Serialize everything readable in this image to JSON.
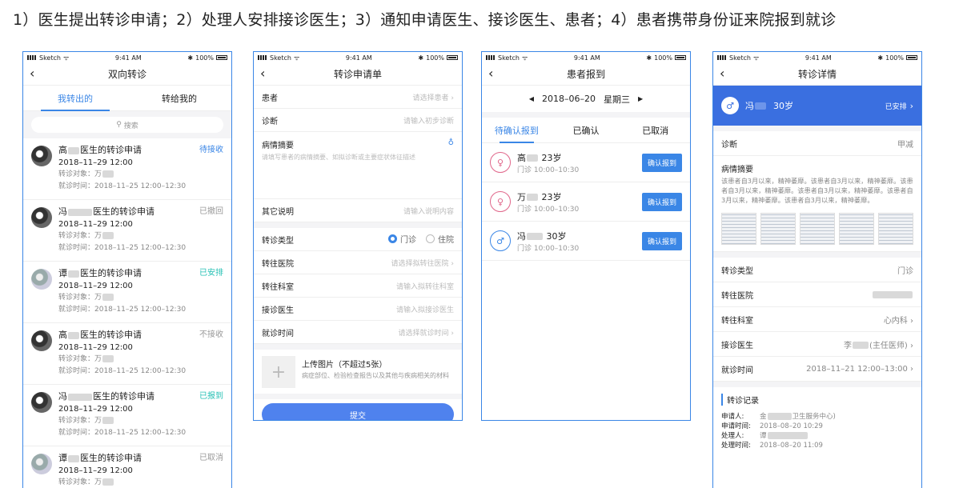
{
  "caption": "1）医生提出转诊申请；2）处理人安排接诊医生；3）通知申请医生、接诊医生、患者；4）患者携带身份证来院报到就诊",
  "statusbar": {
    "carrier": "Sketch",
    "time": "9:41 AM",
    "battery": "100%"
  },
  "phone1": {
    "title": "双向转诊",
    "tabs": [
      "我转出的",
      "转给我的"
    ],
    "search_placeholder": "搜索",
    "items": [
      {
        "name_a": "高",
        "name_b": "医生的转诊申请",
        "status": "待接收",
        "date": "2018–11–29 12:00",
        "target_label": "转诊对象：万",
        "time_text": "就诊时间：2018–11–25 12:00–12:30"
      },
      {
        "name_a": "冯",
        "name_b": "医生的转诊申请",
        "status": "已撤回",
        "date": "2018–11–29 12:00",
        "target_label": "转诊对象：万",
        "time_text": "就诊时间：2018–11–25 12:00–12:30"
      },
      {
        "name_a": "谭",
        "name_b": "医生的转诊申请",
        "status": "已安排",
        "date": "2018–11–29 12:00",
        "target_label": "转诊对象：万",
        "time_text": "就诊时间：2018–11–25 12:00–12:30"
      },
      {
        "name_a": "高",
        "name_b": "医生的转诊申请",
        "status": "不接收",
        "date": "2018–11–29 12:00",
        "target_label": "转诊对象：万",
        "time_text": "就诊时间：2018–11–25 12:00–12:30"
      },
      {
        "name_a": "冯",
        "name_b": "医生的转诊申请",
        "status": "已报到",
        "date": "2018–11–29 12:00",
        "target_label": "转诊对象：万",
        "time_text": "就诊时间：2018–11–25 12:00–12:30"
      },
      {
        "name_a": "谭",
        "name_b": "医生的转诊申请",
        "status": "已取消",
        "date": "2018–11–29 12:00",
        "target_label": "转诊对象：万",
        "time_text": ""
      }
    ]
  },
  "phone2": {
    "title": "转诊申请单",
    "patient": {
      "label": "患者",
      "placeholder": "请选择患者"
    },
    "diagnosis": {
      "label": "诊断",
      "placeholder": "请输入初步诊断"
    },
    "summary": {
      "label": "病情摘要",
      "hint": "请填写患者的病情摘要、如拟诊断或主要症状体征描述"
    },
    "other": {
      "label": "其它说明",
      "placeholder": "请输入说明内容"
    },
    "type": {
      "label": "转诊类型",
      "opt1": "门诊",
      "opt2": "住院"
    },
    "hospital": {
      "label": "转往医院",
      "placeholder": "请选择拟转往医院"
    },
    "dept": {
      "label": "转往科室",
      "placeholder": "请输入拟转往科室"
    },
    "doctor": {
      "label": "接诊医生",
      "placeholder": "请输入拟接诊医生"
    },
    "visit_time": {
      "label": "就诊时间",
      "placeholder": "请选择就诊时间"
    },
    "upload": {
      "title": "上传图片（不超过5张）",
      "desc": "病症部位、检验检查报告以及其他与疾病相关的材料"
    },
    "submit": "提交"
  },
  "phone3": {
    "title": "患者报到",
    "date": "2018–06–20",
    "weekday": "星期三",
    "tabs": [
      "待确认报到",
      "已确认",
      "已取消"
    ],
    "items": [
      {
        "name": "高",
        "age": "23岁",
        "time": "门诊  10:00–10:30",
        "btn": "确认报到",
        "gender": "f"
      },
      {
        "name": "万",
        "age": "23岁",
        "time": "门诊  10:00–10:30",
        "btn": "确认报到",
        "gender": "f"
      },
      {
        "name": "冯",
        "age": "30岁",
        "time": "门诊  10:00–10:30",
        "btn": "确认报到",
        "gender": "m"
      }
    ]
  },
  "phone4": {
    "title": "转诊详情",
    "patient_name": "冯",
    "patient_age": "30岁",
    "status": "已安排",
    "diagnosis_label": "诊断",
    "diagnosis_value": "甲减",
    "summary_label": "病情摘要",
    "summary_text": "该患者自3月以来，精神萎靡。该患者自3月以来，精神萎靡。该患者自3月以来，精神萎靡。该患者自3月以来，精神萎靡。该患者自3月以来，精神萎靡。该患者自3月以来，精神萎靡。",
    "type_label": "转诊类型",
    "type_value": "门诊",
    "hospital_label": "转往医院",
    "dept_label": "转往科室",
    "dept_value": "心内科",
    "doctor_label": "接诊医生",
    "doctor_value": "李",
    "doctor_title": "(主任医师)",
    "time_label": "就诊时间",
    "time_value": "2018–11–21 12:00–13:00",
    "record_title": "转诊记录",
    "applicant_label": "申请人:",
    "applicant_value": "金",
    "applicant_org": "卫生服务中心)",
    "apply_time_label": "申请时间:",
    "apply_time_value": "2018–08–20 10:29",
    "handler_label": "处理人:",
    "handler_value": "谭",
    "handle_time_label": "处理时间:",
    "handle_time_value": "2018–08–20 11:09"
  }
}
